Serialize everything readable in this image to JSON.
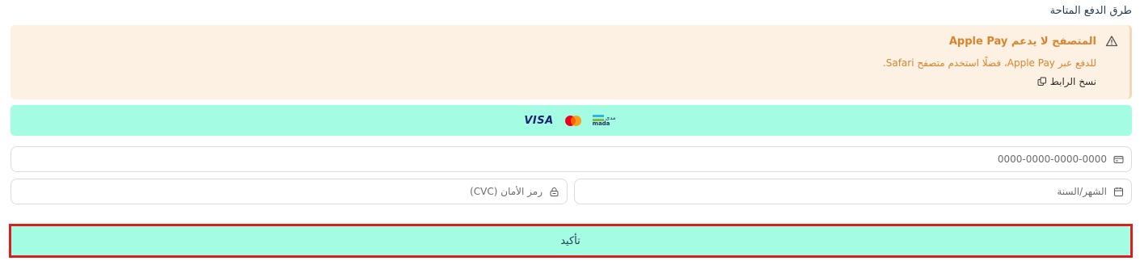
{
  "section": {
    "title": "طرق الدفع المتاحة"
  },
  "alert": {
    "icon": "warning-icon",
    "title": "المتصفح لا يدعم Apple Pay",
    "body": "للدفع عبر Apple Pay، فضلًا استخدم متصفح Safari.",
    "copy_label": "نسخ الرابط",
    "copy_icon": "copy-icon",
    "text_color": "#d9842c",
    "background": "#fdf1e3"
  },
  "brands": {
    "visa": "VISA",
    "mastercard_icon": "mastercard-icon",
    "mada_ar": "مدى",
    "mada_en": "mada",
    "background": "#a4fde3"
  },
  "card_number": {
    "placeholder": "0000-0000-0000-0000",
    "icon": "credit-card-icon"
  },
  "expiry": {
    "placeholder": "الشهر/السنة",
    "icon": "calendar-icon"
  },
  "cvc": {
    "placeholder": "رمز الأمان (CVC)",
    "icon": "lock-icon"
  },
  "confirm": {
    "label": "تأكيد",
    "background": "#a4fde3",
    "highlight_color": "#e01b1b"
  }
}
